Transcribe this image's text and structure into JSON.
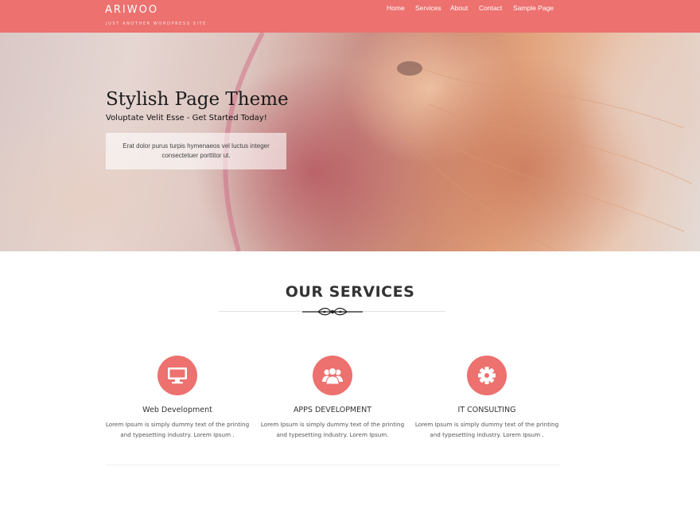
{
  "site": {
    "logo": "ARIWOO",
    "tagline": "JUST ANOTHER WORDPRESS SITE"
  },
  "nav": {
    "items": [
      "Home",
      "Services",
      "About",
      "Contact",
      "Sample Page"
    ]
  },
  "hero": {
    "title": "Stylish Page Theme",
    "subtitle": "Voluptate Velit Esse - Get Started Today!",
    "box_text": "Erat dolor purus turpis hymenaeos vel luctus integer consectetuer porttitor ut."
  },
  "services": {
    "heading": "OUR SERVICES",
    "items": [
      {
        "icon": "monitor-icon",
        "title": "Web Development",
        "text": "Lorem Ipsum is simply dummy text of the printing and typesetting industry. Lorem Ipsum ."
      },
      {
        "icon": "users-icon",
        "title": "APPS DEVELOPMENT",
        "text": "Lorem Ipsum is simply dummy text of the printing and typesetting industry. Lorem Ipsum."
      },
      {
        "icon": "gear-icon",
        "title": "IT CONSULTING",
        "text": "Lorem Ipsum is simply dummy text of the printing and typesetting industry. Lorem Ipsum ."
      }
    ]
  },
  "colors": {
    "accent": "#ec716f",
    "header_bg": "#ec716f"
  }
}
